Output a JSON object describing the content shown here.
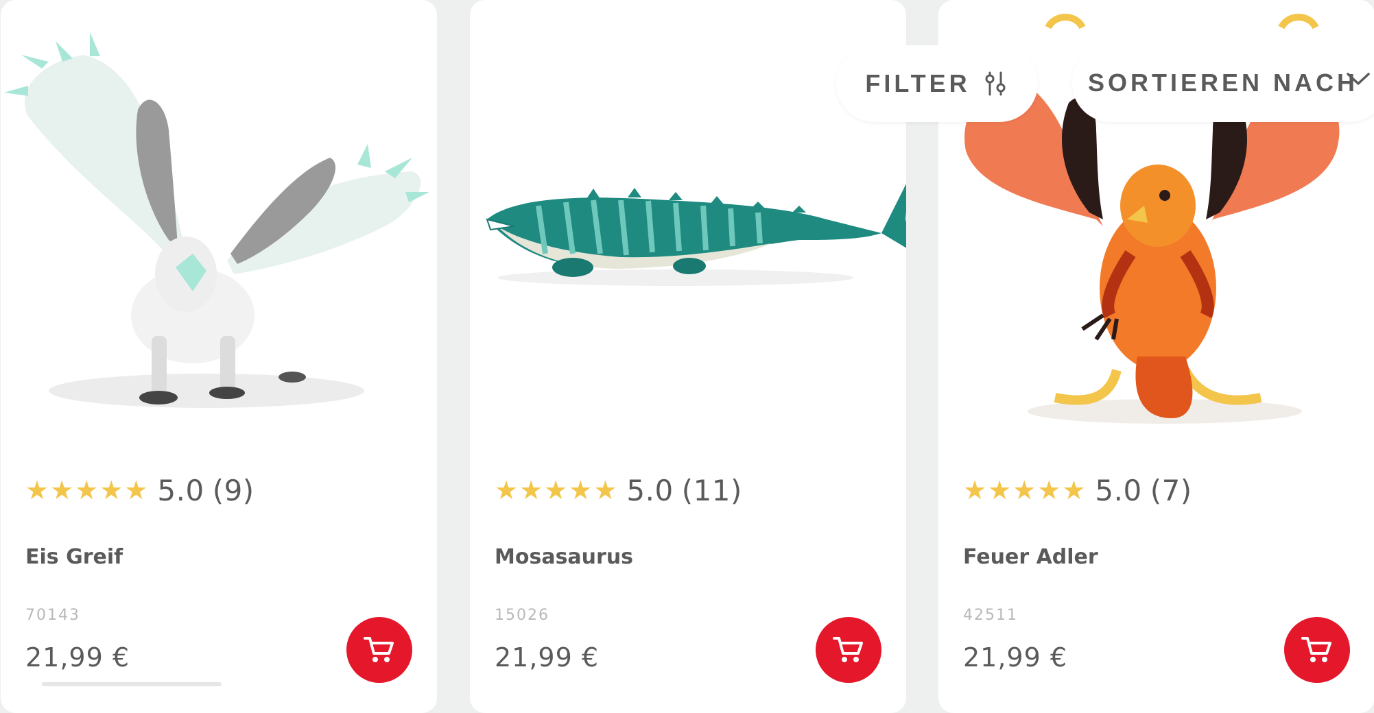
{
  "controls": {
    "filter_label": "FILTER",
    "sort_label": "SORTIEREN NACH"
  },
  "colors": {
    "accent": "#e4172b",
    "star": "#f3c54a",
    "text": "#5a5a5a",
    "muted": "#b8b8b8",
    "background": "#eef0ef"
  },
  "products": [
    {
      "name": "Eis Greif",
      "rating_value": "5.0",
      "rating_count": "(9)",
      "rating_stars": 5,
      "sku": "70143",
      "price": "21,99 €",
      "image": "ice-griffin-figure"
    },
    {
      "name": "Mosasaurus",
      "rating_value": "5.0",
      "rating_count": "(11)",
      "rating_stars": 5,
      "sku": "15026",
      "price": "21,99 €",
      "image": "mosasaurus-figure"
    },
    {
      "name": "Feuer Adler",
      "rating_value": "5.0",
      "rating_count": "(7)",
      "rating_stars": 5,
      "sku": "42511",
      "price": "21,99 €",
      "image": "fire-eagle-figure"
    }
  ]
}
